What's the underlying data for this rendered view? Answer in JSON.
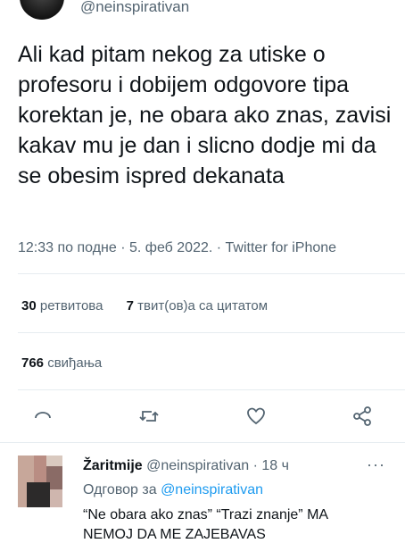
{
  "author": {
    "handle": "@neinspirativan"
  },
  "tweet": {
    "text": "Ali kad pitam nekog za utiske o profesoru i dobijem odgovore tipa korektan je, ne obara ako znas, zavisi kakav mu je dan i slicno dodje mi da se obesim ispred dekanata",
    "meta": "12:33 по подне · 5. феб 2022. · Twitter for iPhone"
  },
  "stats": {
    "retweets_count": "30",
    "retweets_label": "ретвитова",
    "quotes_count": "7",
    "quotes_label": "твит(ов)а са цитатом",
    "likes_count": "766",
    "likes_label": "свиђања"
  },
  "actions": [
    "reply-icon",
    "retweet-icon",
    "like-icon",
    "share-icon"
  ],
  "reply": {
    "name": "Žaritmije",
    "handle": "@neinspirativan",
    "time": "· 18 ч",
    "more": "···",
    "replying_label": "Одговор за",
    "replying_handle": "@neinspirativan",
    "text": "“Ne obara ako znas” “Trazi znanje” MA NEMOJ DA ME ZAJEBAVAS"
  },
  "colors": {
    "text": "#0f1419",
    "secondary": "#536471",
    "accent": "#1d9bf0",
    "divider": "#e6ecf0"
  }
}
